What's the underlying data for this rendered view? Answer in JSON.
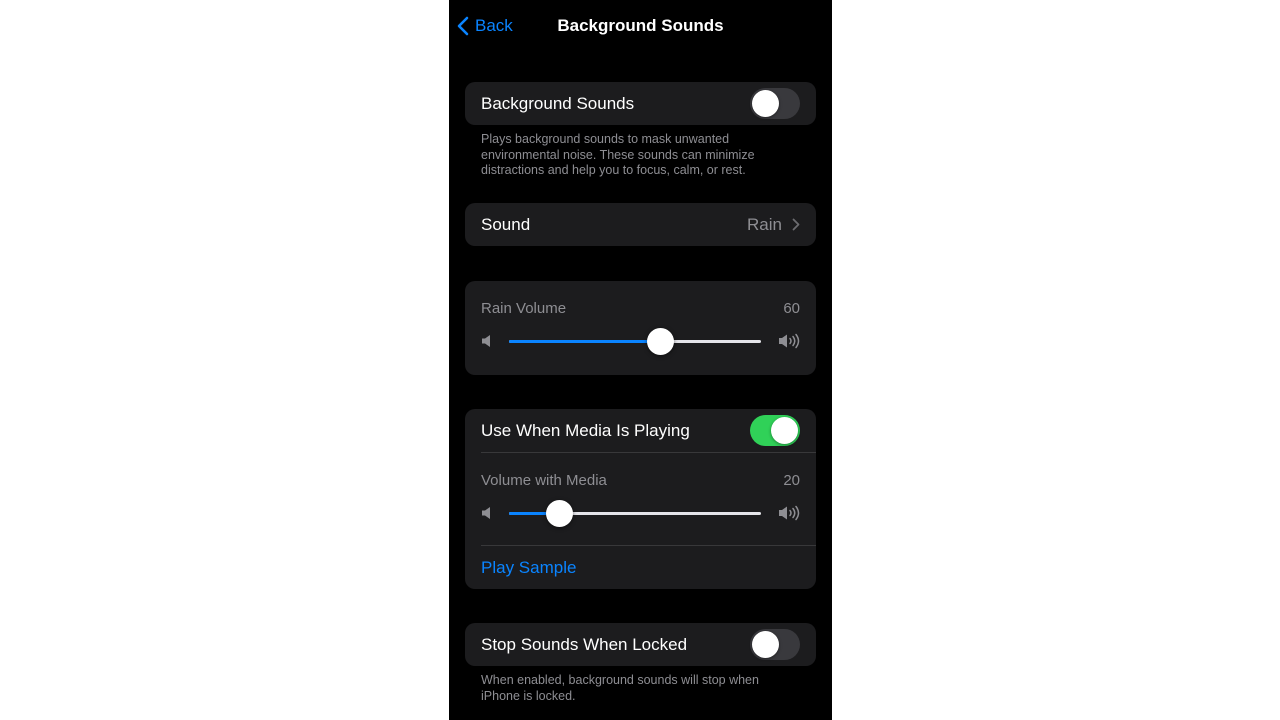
{
  "nav": {
    "back_label": "Back",
    "title": "Background Sounds"
  },
  "background_sounds": {
    "label": "Background Sounds",
    "enabled": false,
    "footnote": "Plays background sounds to mask unwanted environmental noise. These sounds can minimize distractions and help you to focus, calm, or rest."
  },
  "sound": {
    "label": "Sound",
    "value": "Rain"
  },
  "rain_volume": {
    "label": "Rain Volume",
    "value": "60",
    "level": 60
  },
  "media": {
    "label": "Use When Media Is Playing",
    "enabled": true,
    "volume_label": "Volume with Media",
    "volume_value": "20",
    "volume_level": 20,
    "play_sample_label": "Play Sample"
  },
  "stop_locked": {
    "label": "Stop Sounds When Locked",
    "enabled": false,
    "footnote": "When enabled, background sounds will stop when iPhone is locked."
  },
  "colors": {
    "accent": "#0a84ff",
    "toggle_on": "#30d158",
    "toggle_off": "#39393d",
    "cell_background": "#1c1c1e",
    "secondary_text": "#8e8e93"
  },
  "icons": {
    "back": "chevron-left-icon",
    "disclosure": "chevron-right-icon",
    "volume_low": "speaker-low-icon",
    "volume_high": "speaker-high-icon"
  }
}
